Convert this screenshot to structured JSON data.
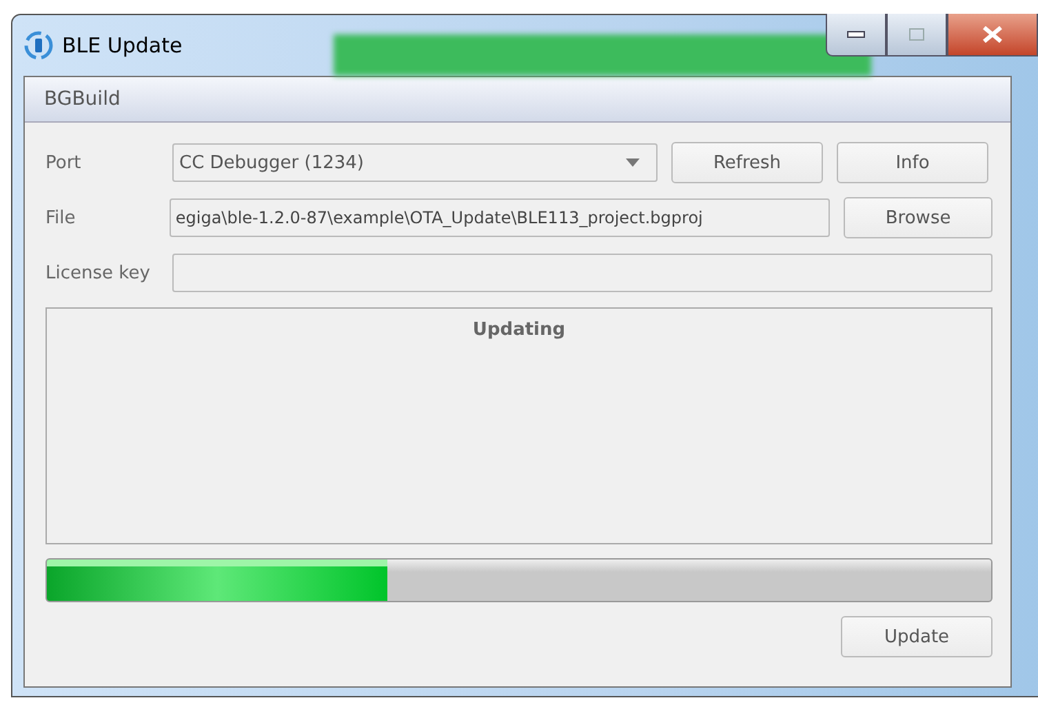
{
  "window": {
    "title": "BLE Update"
  },
  "menu": [
    "BGBuild"
  ],
  "port": {
    "label": "Port",
    "value": "CC Debugger (1234)"
  },
  "file": {
    "label": "File",
    "value": "egiga\\ble-1.2.0-87\\example\\OTA_Update\\BLE113_project.bgproj"
  },
  "license": {
    "label": "License key"
  },
  "buttons": {
    "refresh": "Refresh",
    "info": "Info",
    "browse": "Browse",
    "update": "Update"
  },
  "status": {
    "title": "Updating"
  },
  "progress": {
    "level": 0.36
  }
}
